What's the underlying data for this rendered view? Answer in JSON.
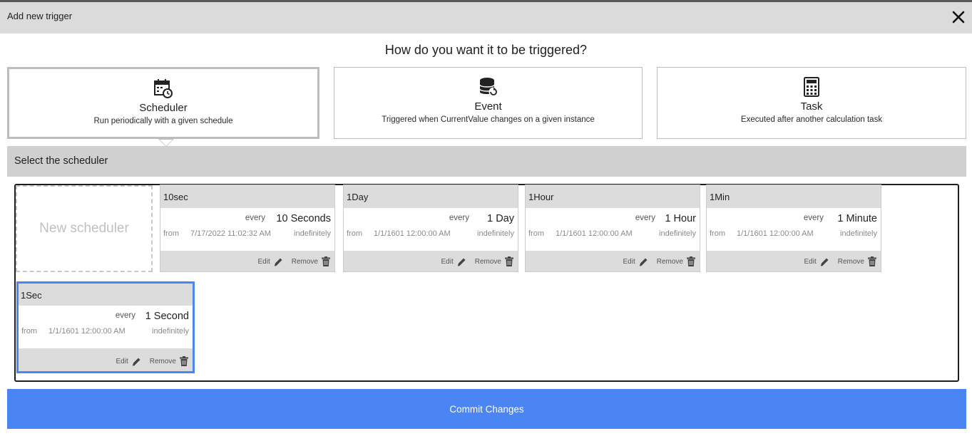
{
  "dialog": {
    "title": "Add new trigger",
    "question": "How do you want it to be triggered?",
    "commit_label": "Commit Changes"
  },
  "trigger_types": [
    {
      "name": "Scheduler",
      "desc": "Run periodically with a given schedule",
      "selected": true,
      "icon": "calendar-clock-icon"
    },
    {
      "name": "Event",
      "desc": "Triggered when CurrentValue changes on a given instance",
      "selected": false,
      "icon": "database-refresh-icon"
    },
    {
      "name": "Task",
      "desc": "Executed after another calculation task",
      "selected": false,
      "icon": "calculator-icon"
    }
  ],
  "section": {
    "label": "Select the scheduler"
  },
  "new_scheduler_label": "New scheduler",
  "labels": {
    "every": "every",
    "from": "from",
    "edit": "Edit",
    "remove": "Remove"
  },
  "schedulers": [
    {
      "name": "10sec",
      "every": "10 Seconds",
      "from": "7/17/2022 11:02:32 AM",
      "until": "indefinitely"
    },
    {
      "name": "1Day",
      "every": "1 Day",
      "from": "1/1/1601 12:00:00 AM",
      "until": "indefinitely"
    },
    {
      "name": "1Hour",
      "every": "1 Hour",
      "from": "1/1/1601 12:00:00 AM",
      "until": "indefinitely"
    },
    {
      "name": "1Min",
      "every": "1 Minute",
      "from": "1/1/1601 12:00:00 AM",
      "until": "indefinitely"
    },
    {
      "name": "1Sec",
      "every": "1 Second",
      "from": "1/1/1601 12:00:00 AM",
      "until": "indefinitely",
      "active": true
    }
  ],
  "colors": {
    "accent": "#4b85f4",
    "header_gray": "#dbdbdb",
    "section_gray": "#d0d0d0"
  }
}
